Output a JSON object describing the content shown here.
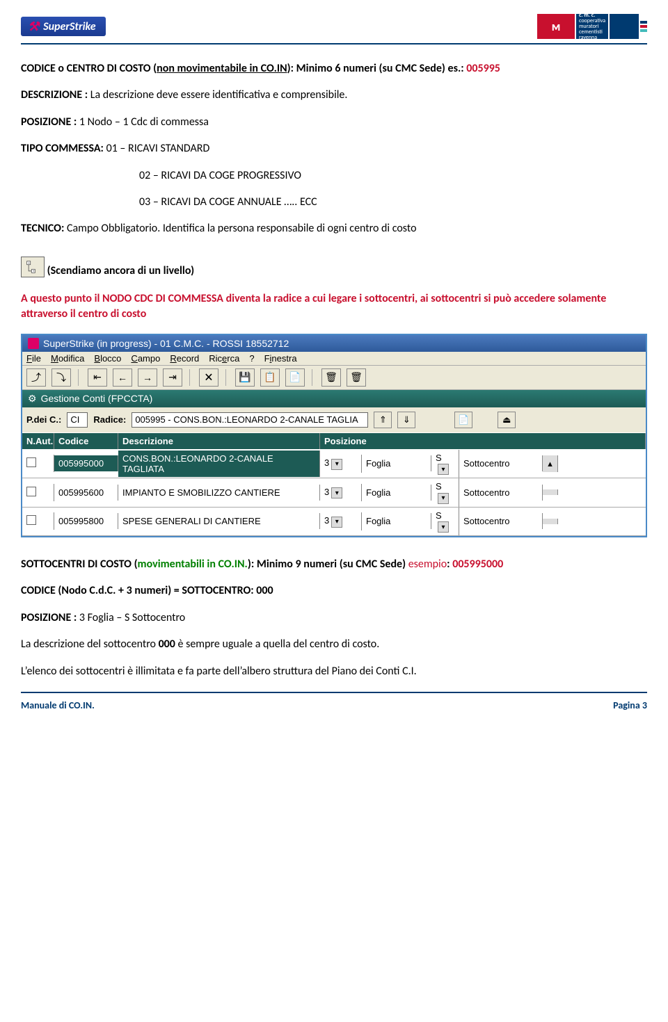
{
  "header": {
    "logo_text": "SuperStrike",
    "cmc_label": "c. m. c.",
    "cmc_desc_1": "cooperativa",
    "cmc_desc_2": "muratori",
    "cmc_desc_3": "cementisti",
    "cmc_desc_4": "ravenna"
  },
  "prose": {
    "l1a": "CODICE o CENTRO DI COSTO (",
    "l1b": "non movimentabile in CO.IN",
    "l1c": "): Minimo 6 numeri  (su CMC Sede) es.: ",
    "l1d": "005995",
    "l2a": "DESCRIZIONE :",
    "l2b": " La descrizione deve essere identificativa e comprensibile.",
    "l3a": "POSIZIONE :",
    "l3b": " 1 Nodo – 1 Cdc di commessa",
    "l4a": "TIPO COMMESSA:",
    "l4b": "  01 – RICAVI STANDARD",
    "l5": "02 – RICAVI DA COGE PROGRESSIVO",
    "l6": "03 – RICAVI DA COGE ANNUALE ….. ECC",
    "l7a": "TECNICO:",
    "l7b": "  Campo Obbligatorio. Identifica la persona responsabile di ogni centro di costo",
    "l8": " (Scendiamo ancora di un livello)",
    "l9": "A questo punto il NODO CDC DI COMMESSA diventa la radice a cui legare i sottocentri, ai sottocentri si può accedere solamente attraverso il centro di costo",
    "l10a": "SOTTOCENTRI DI COSTO (",
    "l10b": "movimentabili in CO.IN.",
    "l10c": "): Minimo 9 numeri  (su CMC Sede) ",
    "l10d": "esempio",
    "l10e": ": ",
    "l10f": "005995000",
    "l11": "CODICE (Nodo C.d.C. + 3 numeri) = SOTTOCENTRO: 000",
    "l12a": "POSIZIONE :",
    "l12b": " 3 Foglia – S Sottocentro",
    "l13a": "La descrizione del sottocentro ",
    "l13b": "000",
    "l13c": " è sempre uguale a quella del centro di costo.",
    "l14": "L’elenco dei sottocentri è illimitata e fa parte dell’albero struttura del Piano dei Conti C.I."
  },
  "ss": {
    "title": "SuperStrike (in progress) - 01 C.M.C. - ROSSI 18552712",
    "menu": {
      "file": "File",
      "modifica": "Modifica",
      "blocco": "Blocco",
      "campo": "Campo",
      "record": "Record",
      "ricerca": "Ricerca",
      "q": "?",
      "finestra": "Finestra"
    },
    "ghead": "Gestione Conti (FPCCTA)",
    "filter": {
      "pdc_label": "P.dei C.:",
      "pdc_val": "CI",
      "radice_label": "Radice:",
      "radice_val": "005995 - CONS.BON.:LEONARDO 2-CANALE TAGLIA"
    },
    "columns": {
      "naut": "N.Aut.",
      "codice": "Codice",
      "desc": "Descrizione",
      "pos": "Posizione"
    },
    "rows": [
      {
        "code": "005995000",
        "desc": "CONS.BON.:LEONARDO 2-CANALE TAGLIATA",
        "pos": "3",
        "ptxt": "Foglia",
        "s": "S",
        "stxt": "Sottocentro"
      },
      {
        "code": "005995600",
        "desc": "IMPIANTO E SMOBILIZZO CANTIERE",
        "pos": "3",
        "ptxt": "Foglia",
        "s": "S",
        "stxt": "Sottocentro"
      },
      {
        "code": "005995800",
        "desc": "SPESE GENERALI DI CANTIERE",
        "pos": "3",
        "ptxt": "Foglia",
        "s": "S",
        "stxt": "Sottocentro"
      }
    ]
  },
  "footer": {
    "left": "Manuale di CO.IN.",
    "right": "Pagina 3"
  }
}
